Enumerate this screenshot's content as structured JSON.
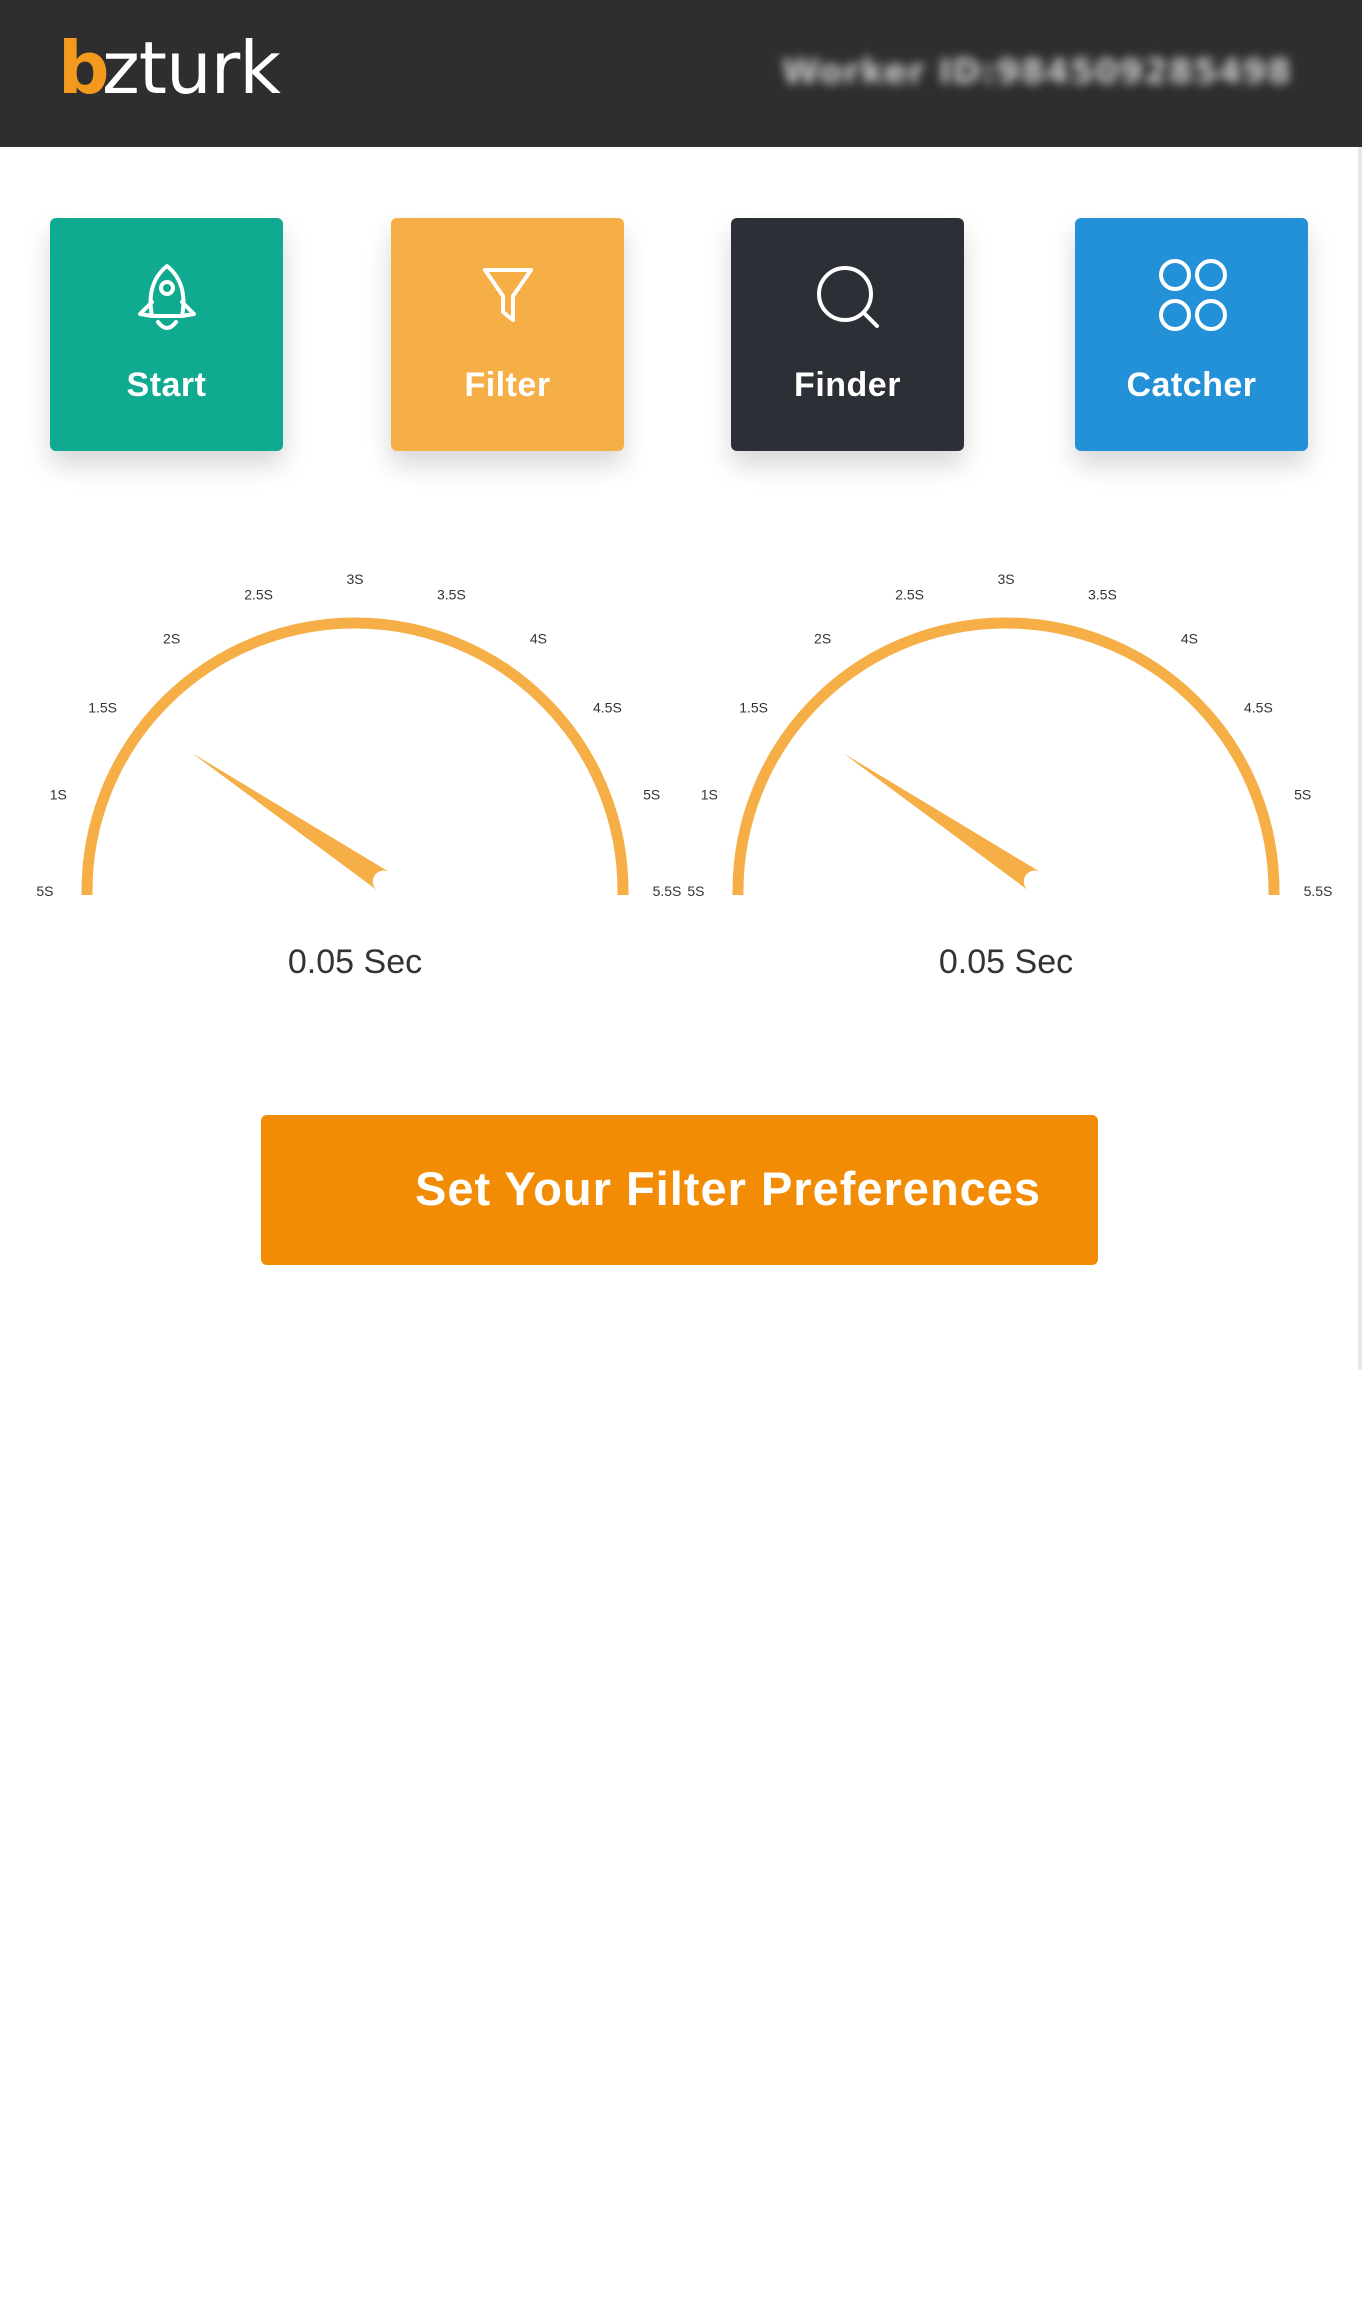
{
  "header": {
    "logo_b": "b",
    "logo_rest": "zturk",
    "worker_id": "Worker ID:984509285498"
  },
  "tiles": [
    {
      "label": "Start",
      "icon": "rocket-icon",
      "color": "#10aa91"
    },
    {
      "label": "Filter",
      "icon": "filter-icon",
      "color": "#f5af46"
    },
    {
      "label": "Finder",
      "icon": "search-icon",
      "color": "#2d2f37"
    },
    {
      "label": "Catcher",
      "icon": "four-circles-icon",
      "color": "#2291d8"
    }
  ],
  "gauges": [
    {
      "ticks": [
        ".5S",
        "1S",
        "1.5S",
        "2S",
        "2.5S",
        "3S",
        "3.5S",
        "4S",
        "4.5S",
        "5S",
        "5.5S"
      ],
      "value_sec": 0.05,
      "readout": "0.05 Sec"
    },
    {
      "ticks": [
        ".5S",
        "1S",
        "1.5S",
        "2S",
        "2.5S",
        "3S",
        "3.5S",
        "4S",
        "4.5S",
        "5S",
        "5.5S"
      ],
      "value_sec": 0.05,
      "readout": "0.05 Sec"
    }
  ],
  "gauge_color": "#f5af46",
  "cta": {
    "label": "Set Your Filter Preferences",
    "icon": "sliders-icon",
    "color": "#f28c04"
  }
}
